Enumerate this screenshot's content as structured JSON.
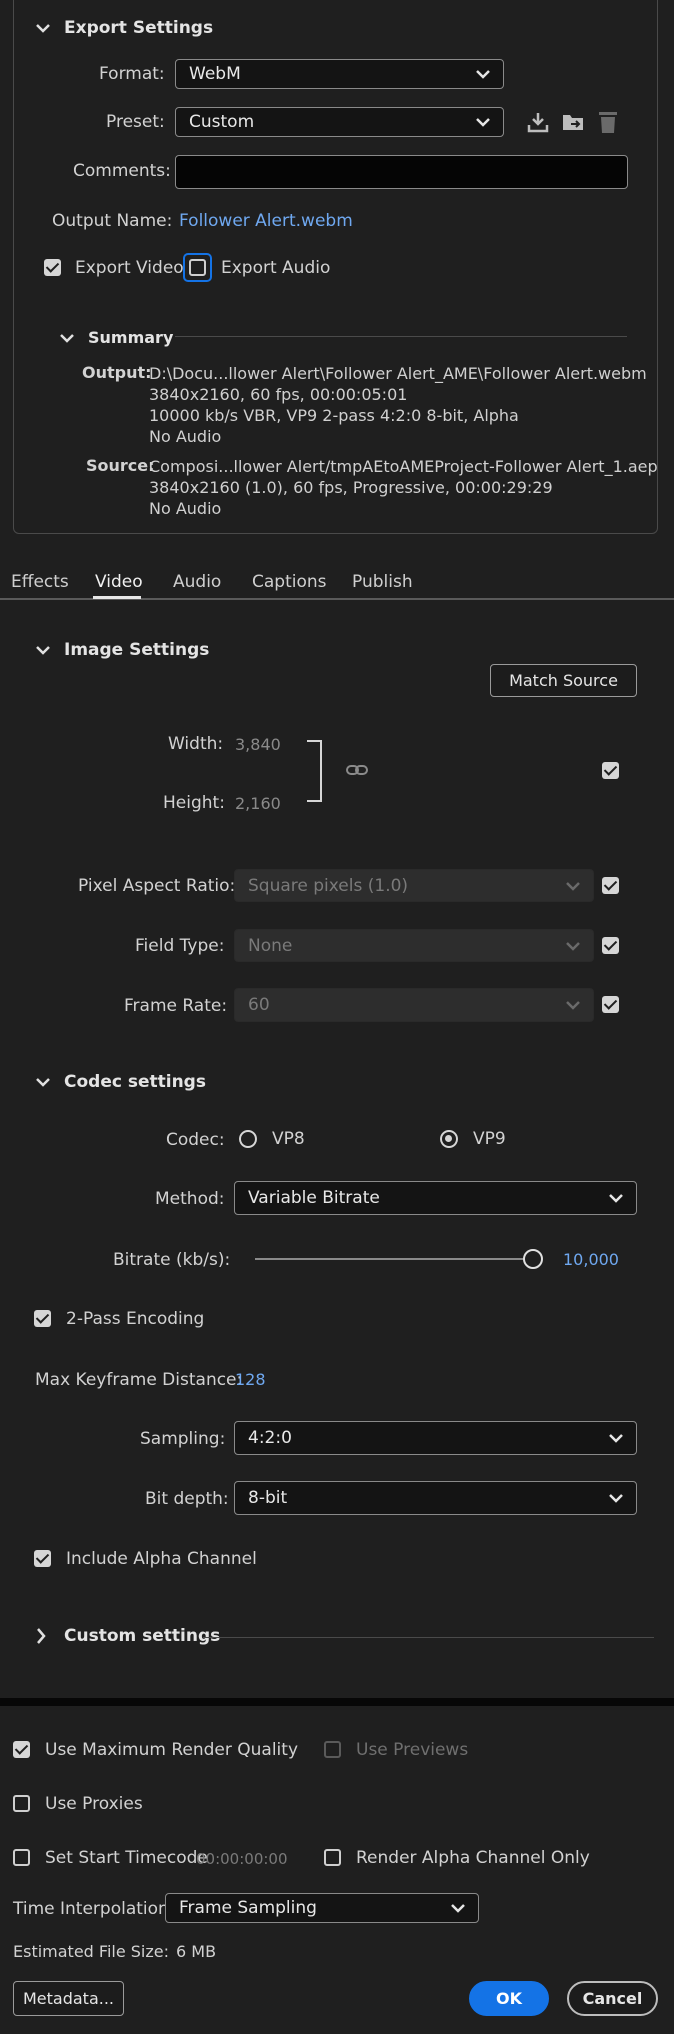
{
  "export_settings": {
    "title": "Export Settings",
    "format_label": "Format:",
    "format_value": "WebM",
    "preset_label": "Preset:",
    "preset_value": "Custom",
    "comments_label": "Comments:",
    "comments_value": "",
    "output_name_label": "Output Name:",
    "output_name_value": "Follower Alert.webm",
    "export_video_label": "Export Video",
    "export_video_checked": true,
    "export_audio_label": "Export Audio",
    "export_audio_checked": false
  },
  "summary": {
    "title": "Summary",
    "output_label": "Output:",
    "output_lines": [
      "D:\\Docu...llower Alert\\Follower Alert_AME\\Follower Alert.webm",
      "3840x2160, 60 fps, 00:00:05:01",
      "10000 kb/s VBR, VP9 2-pass 4:2:0 8-bit, Alpha",
      "No Audio"
    ],
    "source_label": "Source:",
    "source_lines": [
      "Composi...llower Alert/tmpAEtoAMEProject-Follower Alert_1.aep",
      "3840x2160 (1.0), 60 fps, Progressive, 00:00:29:29",
      "No Audio"
    ]
  },
  "tabs": [
    {
      "label": "Effects",
      "active": false
    },
    {
      "label": "Video",
      "active": true
    },
    {
      "label": "Audio",
      "active": false
    },
    {
      "label": "Captions",
      "active": false
    },
    {
      "label": "Publish",
      "active": false
    }
  ],
  "image_settings": {
    "title": "Image Settings",
    "match_source_label": "Match Source",
    "width_label": "Width:",
    "width_value": "3,840",
    "height_label": "Height:",
    "height_value": "2,160",
    "par_label": "Pixel Aspect Ratio:",
    "par_value": "Square pixels (1.0)",
    "field_type_label": "Field Type:",
    "field_type_value": "None",
    "frame_rate_label": "Frame Rate:",
    "frame_rate_value": "60"
  },
  "codec_settings": {
    "title": "Codec settings",
    "codec_label": "Codec:",
    "codec_options": [
      "VP8",
      "VP9"
    ],
    "codec_selected": "VP9",
    "method_label": "Method:",
    "method_value": "Variable Bitrate",
    "bitrate_label": "Bitrate (kb/s):",
    "bitrate_value": "10,000",
    "bitrate_fraction": 1.0,
    "two_pass_label": "2-Pass Encoding",
    "max_keyframe_label": "Max Keyframe Distance:",
    "max_keyframe_value": "128",
    "sampling_label": "Sampling:",
    "sampling_value": "4:2:0",
    "bit_depth_label": "Bit depth:",
    "bit_depth_value": "8-bit",
    "alpha_label": "Include Alpha Channel"
  },
  "custom_settings": {
    "title": "Custom settings"
  },
  "footer": {
    "max_render_label": "Use Maximum Render Quality",
    "use_previews_label": "Use Previews",
    "use_proxies_label": "Use Proxies",
    "start_tc_label": "Set Start Timecode",
    "start_tc_value": "00:00:00:00",
    "alpha_only_label": "Render Alpha Channel Only",
    "time_interp_label": "Time Interpolation:",
    "time_interp_value": "Frame Sampling",
    "est_size_label": "Estimated File Size:",
    "est_size_value": "6 MB",
    "metadata_label": "Metadata...",
    "ok_label": "OK",
    "cancel_label": "Cancel"
  },
  "colors": {
    "accent": "#1473e6",
    "link": "#6fa8f0",
    "background": "#1f1f1f"
  }
}
